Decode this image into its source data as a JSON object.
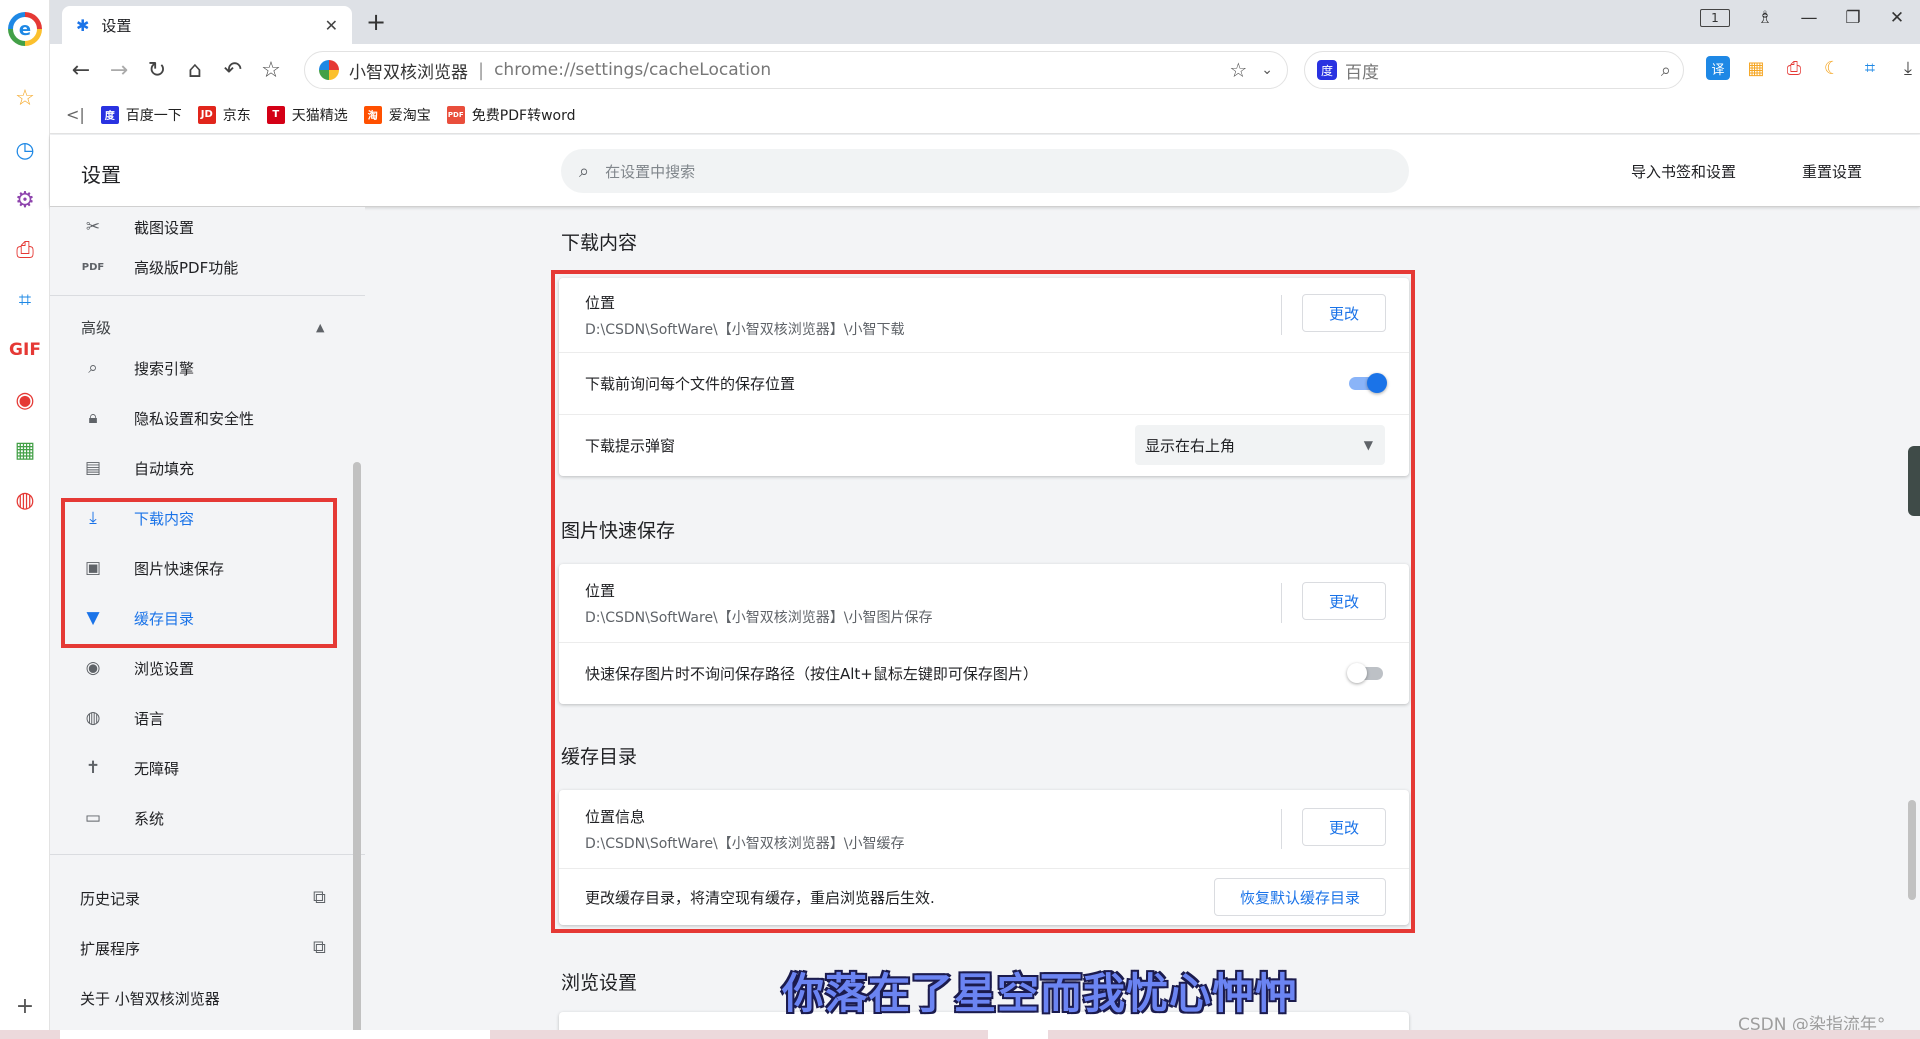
{
  "tab": {
    "title": "设置",
    "close": "✕",
    "new_tab": "+"
  },
  "window": {
    "tab_count": "1"
  },
  "toolbar": {
    "brand": "小智双核浏览器",
    "separator": "|",
    "url": "chrome://settings/cacheLocation",
    "search_placeholder": "百度"
  },
  "bookmarks": [
    {
      "label": "百度一下",
      "icon": "baidu-icon",
      "color": "#2932e1",
      "glyph": "度"
    },
    {
      "label": "京东",
      "icon": "jd-icon",
      "color": "#e1251b",
      "glyph": "JD"
    },
    {
      "label": "天猫精选",
      "icon": "tmall-icon",
      "color": "#d40016",
      "glyph": "T"
    },
    {
      "label": "爱淘宝",
      "icon": "taobao-icon",
      "color": "#ff5000",
      "glyph": "淘"
    },
    {
      "label": "免费PDF转word",
      "icon": "pdf-icon",
      "color": "#e94e3c",
      "glyph": "PDF"
    }
  ],
  "header": {
    "title": "设置",
    "search_placeholder": "在设置中搜索",
    "import_link": "导入书签和设置",
    "reset_link": "重置设置"
  },
  "sidebar": {
    "items_top": [
      {
        "label": "截图设置",
        "icon": "scissors-icon"
      },
      {
        "label": "高级版PDF功能",
        "icon": "pdf-icon"
      }
    ],
    "advanced_label": "高级",
    "items_advanced": [
      {
        "label": "搜索引擎",
        "icon": "search-icon"
      },
      {
        "label": "隐私设置和安全性",
        "icon": "lock-icon"
      },
      {
        "label": "自动填充",
        "icon": "clipboard-icon"
      },
      {
        "label": "下载内容",
        "icon": "download-icon"
      },
      {
        "label": "图片快速保存",
        "icon": "image-icon"
      },
      {
        "label": "缓存目录",
        "icon": "cache-icon"
      },
      {
        "label": "浏览设置",
        "icon": "eye-icon"
      },
      {
        "label": "语言",
        "icon": "globe-icon"
      },
      {
        "label": "无障碍",
        "icon": "accessibility-icon"
      },
      {
        "label": "系统",
        "icon": "monitor-icon"
      }
    ],
    "history": "历史记录",
    "extensions": "扩展程序",
    "about": "关于 小智双核浏览器"
  },
  "downloads": {
    "title": "下载内容",
    "location_label": "位置",
    "location_value": "D:\\CSDN\\SoftWare\\【小智双核浏览器】\\小智下载",
    "change_button": "更改",
    "ask_label": "下载前询问每个文件的保存位置",
    "ask_enabled": true,
    "popup_label": "下载提示弹窗",
    "popup_value": "显示在右上角"
  },
  "image_save": {
    "title": "图片快速保存",
    "location_label": "位置",
    "location_value": "D:\\CSDN\\SoftWare\\【小智双核浏览器】\\小智图片保存",
    "change_button": "更改",
    "noask_label": "快速保存图片时不询问保存路径（按住Alt+鼠标左键即可保存图片）",
    "noask_enabled": false
  },
  "cache": {
    "title": "缓存目录",
    "location_label": "位置信息",
    "location_value": "D:\\CSDN\\SoftWare\\【小智双核浏览器】\\小智缓存",
    "change_button": "更改",
    "note": "更改缓存目录，将清空现有缓存，重启浏览器后生效.",
    "restore_button": "恢复默认缓存目录"
  },
  "browse": {
    "title": "浏览设置"
  },
  "overlay": {
    "caption": "你落在了星空而我忧心忡忡",
    "watermark": "CSDN @染指流年°"
  },
  "colors": {
    "accent": "#1a73e8",
    "highlight": "#e53935"
  }
}
